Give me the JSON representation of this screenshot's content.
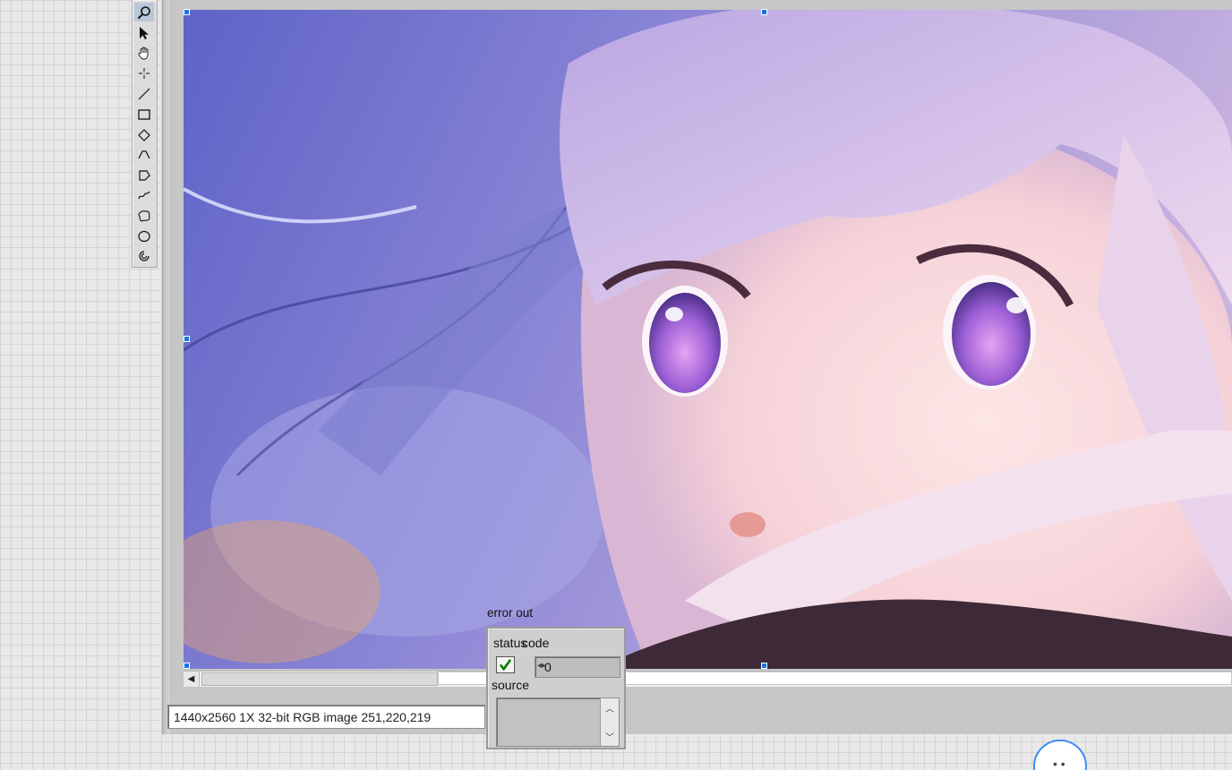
{
  "palette": {
    "tools": [
      {
        "name": "zoom-tool",
        "icon": "magnifier-icon",
        "active": true
      },
      {
        "name": "selection-tool",
        "icon": "arrow-cursor-icon",
        "active": false
      },
      {
        "name": "pan-tool",
        "icon": "hand-icon",
        "active": false
      },
      {
        "name": "point-tool",
        "icon": "crosshair-icon",
        "active": false
      },
      {
        "name": "line-tool",
        "icon": "line-icon",
        "active": false
      },
      {
        "name": "rectangle-tool",
        "icon": "rectangle-icon",
        "active": false
      },
      {
        "name": "rotated-rectangle-tool",
        "icon": "diamond-icon",
        "active": false
      },
      {
        "name": "polyline-tool",
        "icon": "polyline-icon",
        "active": false
      },
      {
        "name": "polygon-tool",
        "icon": "polygon-icon",
        "active": false
      },
      {
        "name": "freehand-line-tool",
        "icon": "freehand-line-icon",
        "active": false
      },
      {
        "name": "freehand-region-tool",
        "icon": "freehand-region-icon",
        "active": false
      },
      {
        "name": "oval-tool",
        "icon": "oval-icon",
        "active": false
      },
      {
        "name": "annulus-tool",
        "icon": "annulus-icon",
        "active": false
      }
    ]
  },
  "image_display": {
    "status_text": "1440x2560 1X 32-bit RGB image 251,220,219"
  },
  "error_out": {
    "label": "error out",
    "status_label": "status",
    "code_label": "code",
    "code_value": "0",
    "code_increment_glyph": "◂▸",
    "source_label": "source",
    "source_value": "",
    "status_ok": true
  },
  "colors": {
    "selection_handle": "#1a74e8",
    "status_check": "#17a317"
  }
}
